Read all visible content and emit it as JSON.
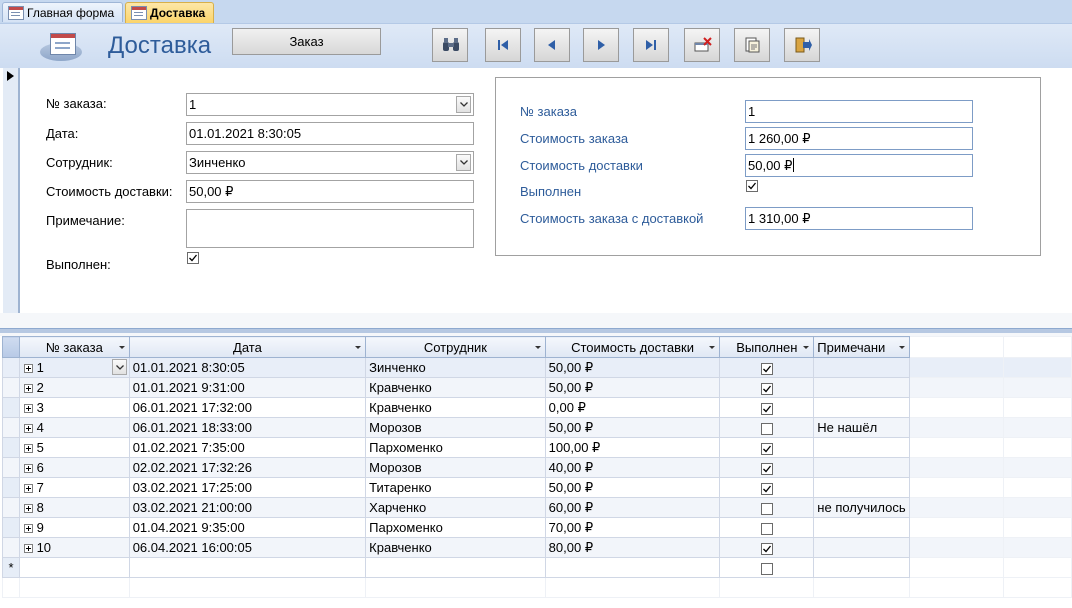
{
  "tabs": [
    {
      "label": "Главная форма",
      "active": false
    },
    {
      "label": "Доставка",
      "active": true
    }
  ],
  "header": {
    "title": "Доставка",
    "order_button": "Заказ",
    "nav_icons": [
      "binoculars-icon",
      "first-record-icon",
      "previous-record-icon",
      "next-record-icon",
      "last-record-icon",
      "delete-record-icon",
      "report-icon",
      "exit-icon"
    ]
  },
  "form": {
    "order_no_label": "№ заказа:",
    "order_no_value": "1",
    "date_label": "Дата:",
    "date_value": "01.01.2021 8:30:05",
    "employee_label": "Сотрудник:",
    "employee_value": "Зинченко",
    "delivery_cost_label": "Стоимость доставки:",
    "delivery_cost_value": "50,00 ₽",
    "note_label": "Примечание:",
    "note_value": "",
    "done_label": "Выполнен:",
    "done_checked": true
  },
  "subform": {
    "order_no_label": "№ заказа",
    "order_no_value": "1",
    "order_cost_label": "Стоимость заказа",
    "order_cost_value": "1 260,00 ₽",
    "delivery_cost_label": "Стоимость доставки",
    "delivery_cost_value": "50,00 ₽",
    "done_label": "Выполнен",
    "done_checked": true,
    "total_label": "Стоимость заказа с доставкой",
    "total_value": "1 310,00 ₽"
  },
  "table": {
    "columns": [
      "№ заказа",
      "Дата",
      "Сотрудник",
      "Стоимость доставки",
      "Выполнен",
      "Примечани"
    ],
    "rows": [
      {
        "order": "1",
        "date": "01.01.2021 8:30:05",
        "employee": "Зинченко",
        "cost": "50,00 ₽",
        "done": true,
        "note": ""
      },
      {
        "order": "2",
        "date": "01.01.2021 9:31:00",
        "employee": "Кравченко",
        "cost": "50,00 ₽",
        "done": true,
        "note": ""
      },
      {
        "order": "3",
        "date": "06.01.2021 17:32:00",
        "employee": "Кравченко",
        "cost": "0,00 ₽",
        "done": true,
        "note": ""
      },
      {
        "order": "4",
        "date": "06.01.2021 18:33:00",
        "employee": "Морозов",
        "cost": "50,00 ₽",
        "done": false,
        "note": "Не нашёл"
      },
      {
        "order": "5",
        "date": "01.02.2021 7:35:00",
        "employee": "Пархоменко",
        "cost": "100,00 ₽",
        "done": true,
        "note": ""
      },
      {
        "order": "6",
        "date": "02.02.2021 17:32:26",
        "employee": "Морозов",
        "cost": "40,00 ₽",
        "done": true,
        "note": ""
      },
      {
        "order": "7",
        "date": "03.02.2021 17:25:00",
        "employee": "Титаренко",
        "cost": "50,00 ₽",
        "done": true,
        "note": ""
      },
      {
        "order": "8",
        "date": "03.02.2021 21:00:00",
        "employee": "Харченко",
        "cost": "60,00 ₽",
        "done": false,
        "note": "не получилось"
      },
      {
        "order": "9",
        "date": "01.04.2021 9:35:00",
        "employee": "Пархоменко",
        "cost": "70,00 ₽",
        "done": false,
        "note": ""
      },
      {
        "order": "10",
        "date": "06.04.2021 16:00:05",
        "employee": "Кравченко",
        "cost": "80,00 ₽",
        "done": true,
        "note": ""
      }
    ],
    "new_row_marker": "*"
  }
}
